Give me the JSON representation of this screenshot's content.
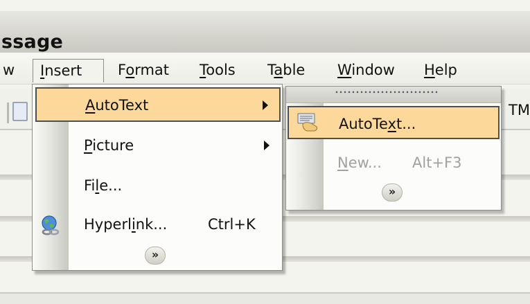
{
  "window": {
    "title_fragment": "ssage"
  },
  "menubar": {
    "items": [
      {
        "label": "w",
        "mnemonic": ""
      },
      {
        "label": "Insert",
        "mnemonic": "I"
      },
      {
        "label": "Format",
        "mnemonic": "o"
      },
      {
        "label": "Tools",
        "mnemonic": "T"
      },
      {
        "label": "Table",
        "mnemonic": "a"
      },
      {
        "label": "Window",
        "mnemonic": "W"
      },
      {
        "label": "Help",
        "mnemonic": "H"
      }
    ],
    "active": "Insert"
  },
  "toolbar": {
    "trailing_text": "TML"
  },
  "insert_menu": {
    "items": [
      {
        "label": "AutoText",
        "mnemonic": "A",
        "has_submenu": true,
        "highlighted": true,
        "shortcut": "",
        "icon": ""
      },
      {
        "label": "Picture",
        "mnemonic": "P",
        "has_submenu": true,
        "highlighted": false,
        "shortcut": "",
        "icon": ""
      },
      {
        "label": "File...",
        "mnemonic": "l",
        "has_submenu": false,
        "highlighted": false,
        "shortcut": "",
        "icon": ""
      },
      {
        "label": "Hyperlink...",
        "mnemonic": "i",
        "has_submenu": false,
        "highlighted": false,
        "shortcut": "Ctrl+K",
        "icon": "hyperlink-globe-icon"
      }
    ],
    "expand_glyph": "»"
  },
  "autotext_submenu": {
    "items": [
      {
        "label": "AutoText...",
        "mnemonic": "x",
        "highlighted": true,
        "enabled": true,
        "shortcut": "",
        "icon": "autotext-hand-icon"
      },
      {
        "label": "New...",
        "mnemonic": "N",
        "highlighted": false,
        "enabled": false,
        "shortcut": "Alt+F3",
        "icon": ""
      }
    ],
    "expand_glyph": "»"
  },
  "colors": {
    "highlight": "#fcd99a",
    "highlight_border": "#4f4f4f",
    "disabled_text": "#a1a1a1",
    "menu_background": "#fcfcfa"
  }
}
